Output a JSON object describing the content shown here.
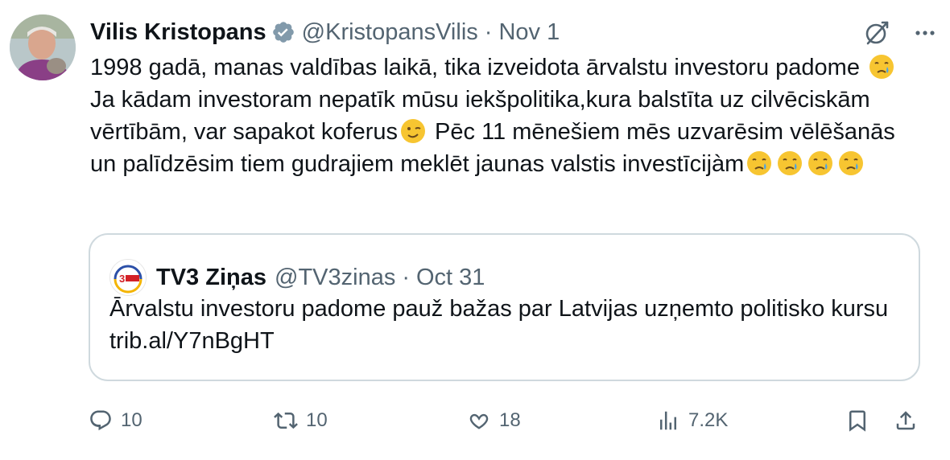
{
  "author": {
    "name": "Vilis Kristopans",
    "handle": "@KristopansVilis",
    "separator": "·",
    "date": "Nov 1"
  },
  "tweet": {
    "line1": "1998 gadā, manas valdības laikā, tika izveidota ārvalstu investoru padome",
    "segment2": " Ja kādam investoram nepatīk mūsu iekšpolitika,kura balstīta uz cilvēciskām vērtībām, var sapakot koferus",
    "segment3": " Pēc 11 mēnešiem mēs uzvarēsim vēlēšanās un palīdzēsim tiem gudrajiem meklēt jaunas valstis investīcijàm"
  },
  "quote": {
    "name": "TV3 Ziņas",
    "handle": "@TV3zinas",
    "separator": "·",
    "date": "Oct 31",
    "text": "Ārvalstu investoru padome pauž bažas par Latvijas uzņemto politisko kursu trib.al/Y7nBgHT",
    "logo_text": "3 Ziņas"
  },
  "actions": {
    "replies": "10",
    "reposts": "10",
    "likes": "18",
    "views": "7.2K"
  },
  "icons": {
    "verified": "verified-badge-icon",
    "grok": "grok-icon",
    "more": "more-icon",
    "reply": "reply-icon",
    "repost": "repost-icon",
    "like": "heart-icon",
    "views": "views-icon",
    "bookmark": "bookmark-icon",
    "share": "share-icon"
  },
  "colors": {
    "text": "#0f1419",
    "secondary": "#536471",
    "border": "#cfd9de",
    "verified": "#829aab"
  }
}
